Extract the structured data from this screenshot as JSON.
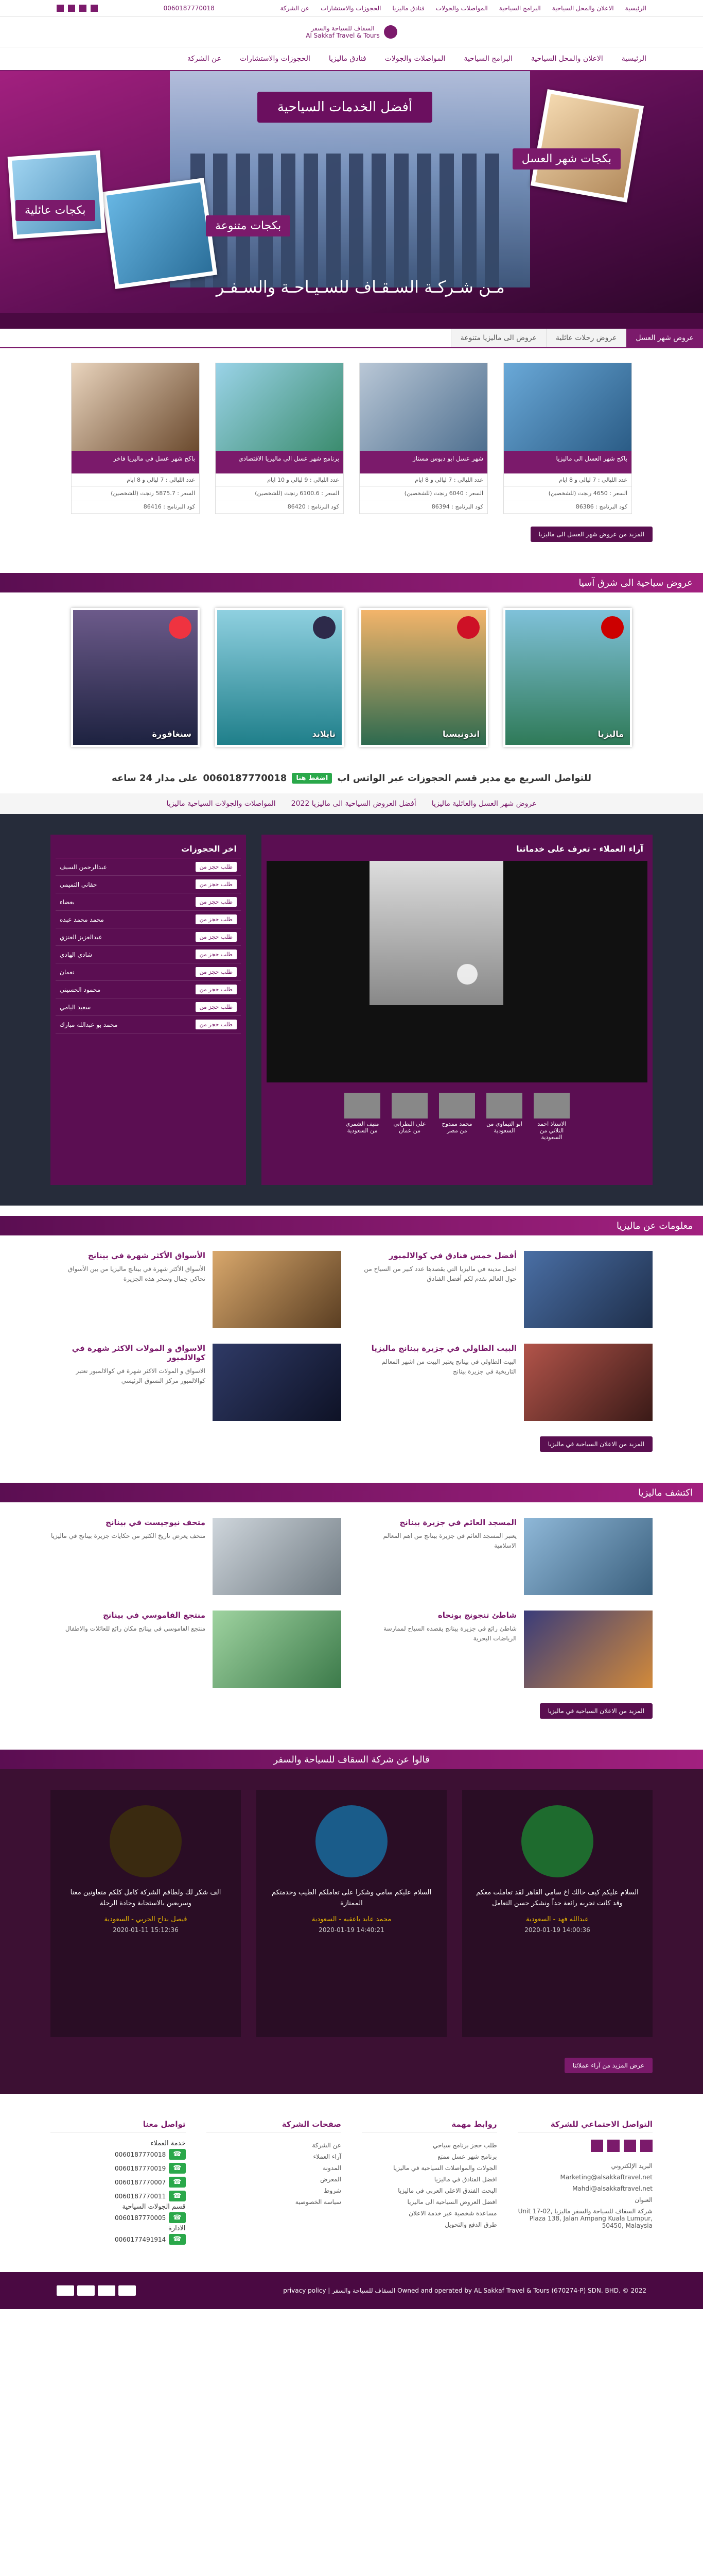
{
  "topbar": {
    "links": [
      "الرئيسية",
      "الاعلان والمحل السياحية",
      "البرامج السياحية",
      "المواصلات والجولات",
      "فنادق ماليزيا",
      "الحجوزات والاستشارات",
      "عن الشركة"
    ],
    "phone": "0060187770018"
  },
  "brand": {
    "name_ar": "السقاف للسياحة والسفر",
    "name_en": "Al Sakkaf Travel & Tours"
  },
  "nav": {
    "items": [
      "الرئيسية",
      "الاعلان والمحل السياحية",
      "البرامج السياحية",
      "المواصلات والجولات",
      "فنادق ماليزيا",
      "الحجوزات والاستشارات",
      "عن الشركة"
    ]
  },
  "hero": {
    "title": "أفضل الخدمات السياحية",
    "badges": [
      "بكجات شهر العسل",
      "بكجات متنوعة",
      "بكجات عائلية"
    ],
    "tagline": "مـن شـركـة السـقـاف للسـيـاحـة والسـفـر"
  },
  "package_tabs": [
    "عروض شهر العسل",
    "عروض رحلات عائلية",
    "عروض الى ماليزيا متنوعة"
  ],
  "packages": [
    {
      "title": "باكج شهر العسل الى ماليزيا",
      "duration": "عدد الليالي : 7 ليالي و 8 ايام",
      "price": "السعر : 4650 رنجت (للشخصين)",
      "code": "كود البرنامج : 86386"
    },
    {
      "title": "شهر عسل ابو دبوس مستاز",
      "duration": "عدد الليالي : 7 ليالي و 8 ايام",
      "price": "السعر : 6040 رنجت (للشخصين)",
      "code": "كود البرنامج : 86394"
    },
    {
      "title": "برنامج شهر عسل الى ماليزيا الاقتصادي",
      "duration": "عدد الليالي : 9 ليالي و 10 ايام",
      "price": "السعر : 6100.6 رنجت (للشخصين)",
      "code": "كود البرنامج : 86420"
    },
    {
      "title": "باكج شهر عسل في ماليزيا فاخر",
      "duration": "عدد الليالي : 7 ليالي و 8 ايام",
      "price": "السعر : 5875.7 رنجت (للشخصين)",
      "code": "كود البرنامج : 86416"
    }
  ],
  "packages_more": "المزيد من عروض شهر العسل الى ماليزيا",
  "asia": {
    "title": "عروض سياحية الى شرق آسيا",
    "countries": [
      {
        "name": "ماليزيا",
        "flag": "#cc0000"
      },
      {
        "name": "اندونيسيا",
        "flag": "#ce1126"
      },
      {
        "name": "تايلاند",
        "flag": "#2d2a4a"
      },
      {
        "name": "سنغافورة",
        "flag": "#ef3340"
      }
    ]
  },
  "contact": {
    "text": "للتواصل السريع مع مدير قسم الحجوزات عبر الواتس اب",
    "wa": "اضغط هنا",
    "phone": "0060187770018",
    "suffix": "على مدار 24 ساعه"
  },
  "ticker": [
    "عروض شهر العسل والعائلية ماليزيا",
    "أفضل العروض السياحية الى ماليزيا 2022",
    "المواصلات والجولات السياحية ماليزيا"
  ],
  "bookings": {
    "title": "اخر الحجوزات",
    "btn": "طلب حجز من",
    "names": [
      "عبدالرحمن السيف",
      "حقاني التميمي",
      "بعضاء",
      "محمد محمد عبده",
      "عبدالعزيز العنزي",
      "شادي الهادي",
      "نعمان",
      "محمود الحسيني",
      "سعيد اليامي",
      "محمد بو عبدالله مبارك"
    ]
  },
  "opinions": {
    "title": "آراء العملاء - تعرف على خدماتنا",
    "thumbs": [
      "الاستاذ احمد التلاني من السعودية",
      "ابو التيماوي من السعودية",
      "محمد ممدوح من مصر",
      "علي البطرانى من عمان",
      "منيف الشمري من السعودية"
    ]
  },
  "malaysia_info": {
    "title": "معلومات عن ماليزيا",
    "items": [
      {
        "h": "أفضل خمس فنادق في كوالالمبور",
        "p": "اجمل مدينة في ماليزيا التي يقصدها عدد كبير من السياح من حول العالم نقدم لكم أفضل الفنادق"
      },
      {
        "h": "الأسواق الأكثر شهرة في بينانج",
        "p": "الأسواق الأكثر شهرة في بينانج ماليزيا من بين الأسواق تحاكي جمال وسحر هذه الجزيرة"
      },
      {
        "h": "البيت الطاولي في جزيرة بينانج ماليزيا",
        "p": "البيت الطاولي في بينانج يعتبر البيت من اشهر المعالم التاريخية في جزيرة بينانج"
      },
      {
        "h": "الاسواق و المولات الاكثر شهرة في كوالالمبور",
        "p": "الاسواق و المولات الاكثر شهرة في كوالالمبور تعتبر كوالالمبور مركز التسوق الرئيسي"
      }
    ],
    "more": "المزيد من الاعلان السياحية في ماليزيا"
  },
  "explore": {
    "title": "اكتشف ماليزيا",
    "items": [
      {
        "h": "المسجد العائم في جزيرة بينانج",
        "p": "يعتبر المسجد العائم في جزيرة بينانج من اهم المعالم الاسلامية"
      },
      {
        "h": "متحف نيوجيست في بينانج",
        "p": "متحف يعرض تاريخ الكثير من حكايات جزيرة بينانج في ماليزيا"
      },
      {
        "h": "شاطئ تنجونج بونجاه",
        "p": "شاطئ رائع في جزيرة بينانج يقصده السياح لممارسة الرياضات البحرية"
      },
      {
        "h": "منتجع الفاموسي في بينانج",
        "p": "منتجع الفاموسي في بينانج مكان رائع للعائلات والاطفال"
      }
    ],
    "more": "المزيد من الاعلان السياحية في ماليزيا"
  },
  "testimonials": {
    "title": "قالوا عن شركة السقاف للسياحة والسفر",
    "items": [
      {
        "text": "السلام عليكم كيف حالك اخ سامي القاهر لقد تعاملت معكم وقد كانت تجربه رائعة جداً ونشكر حسن التعامل",
        "who": "عبدالله فهد - السعودية",
        "date": "14:00:36 2020-01-19"
      },
      {
        "text": "السلام عليكم سامي وشكرا على تعاملكم الطيب وخدمتكم الممتازة",
        "who": "محمد عابد باعقيه - السعودية",
        "date": "14:40:21 2020-01-19"
      },
      {
        "text": "الف شكر لك ولطاقم الشركة كامل كلكم متعاونين معنا وسريعين بالاستجابة وجادة الرحلة",
        "who": "فيصل بداح الحربي - السعودية",
        "date": "15:12:36 2020-01-11"
      }
    ],
    "more": "عرض المزيد من آراء عملائنا"
  },
  "footer": {
    "social_title": "التواصل الاجتماعي للشركة",
    "email_label": "البريد الإلكتروني",
    "emails": [
      "Marketing@alsakkaftravel.net",
      "Mahdi@alsakkaftravel.net"
    ],
    "address_label": "العنوان",
    "address": "شركة السقاف للسياحة والسفر ماليزيا Unit 17-02, Plaza 138, Jalan Ampang Kuala Lumpur, 50450, Malaysia",
    "links_title": "روابط مهمة",
    "links": [
      "طلب حجز برنامج سياحي",
      "برنامج شهر عسل ممتع",
      "الجولات والمواصلات السياحية في ماليزيا",
      "افضل الفنادق في ماليزيا",
      "البحث الفندق الاعلى العربي في ماليزيا",
      "افضل العروض السياحية الى ماليزيا",
      "مساعدة شخصية عبر خدمة الاعلان",
      "طرق الدفع والتحويل"
    ],
    "pages_title": "صفحات الشركة",
    "pages": [
      "عن الشركة",
      "آراء العملاء",
      "المدونة",
      "المعرض",
      "شروط",
      "سياسة الخصوصية"
    ],
    "contact_title": "تواصل معنا",
    "contact": [
      {
        "label": "خدمة العملاء",
        "phone": "0060187770018"
      },
      {
        "label": "",
        "phone": "0060187770019"
      },
      {
        "label": "",
        "phone": "0060187770007"
      },
      {
        "label": "",
        "phone": "0060187770011"
      },
      {
        "label": "قسم الجولات السياحية",
        "phone": "0060187770005"
      },
      {
        "label": "الادارة",
        "phone": "0060177491914"
      }
    ]
  },
  "bottom": {
    "copy": "Owned and operated by AL Sakkaf Travel & Tours (670274-P) SDN. BHD. © 2022 السقاف للسياحة والسفر",
    "privacy": "privacy policy"
  }
}
